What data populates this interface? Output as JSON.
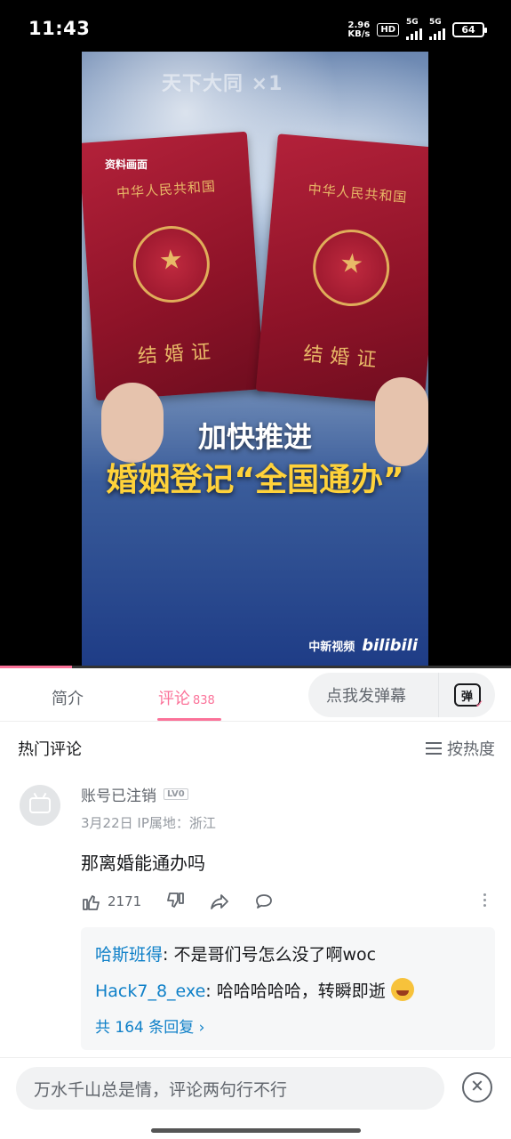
{
  "status_bar": {
    "time": "11:43",
    "net_speed_value": "2.96",
    "net_speed_unit": "KB/s",
    "hd_label": "HD",
    "signal1": "5G",
    "signal2": "5G",
    "battery": "64"
  },
  "video": {
    "watermark": "天下大同 ×1",
    "source_tag": "资料画面",
    "book_nation": "中华人民共和国",
    "book_title": "结婚证",
    "caption_line1": "加快推进",
    "caption_line2": "婚姻登记“全国通办”",
    "channel": "中新视频",
    "platform_logo": "bilibili",
    "progress_fraction": 0.14
  },
  "tabs": {
    "intro": "简介",
    "comments": "评论",
    "comments_count": "838",
    "danmaku_placeholder": "点我发弹幕",
    "danmaku_icon_text": "弹"
  },
  "hot": {
    "title": "热门评论",
    "sort_label": "按热度"
  },
  "comment": {
    "username": "账号已注销",
    "level": "LV0",
    "date": "3月22日",
    "ip_location": "IP属地：浙江",
    "text": "那离婚能通办吗",
    "likes": "2171"
  },
  "replies": [
    {
      "name": "哈斯班得",
      "text": ": 不是哥们号怎么没了啊woc"
    },
    {
      "name": "Hack7_8_exe",
      "text": ": 哈哈哈哈哈，转瞬即逝"
    }
  ],
  "reply_more": "共 164 条回复 ›",
  "input_placeholder": "万水千山总是情，评论两句行不行"
}
